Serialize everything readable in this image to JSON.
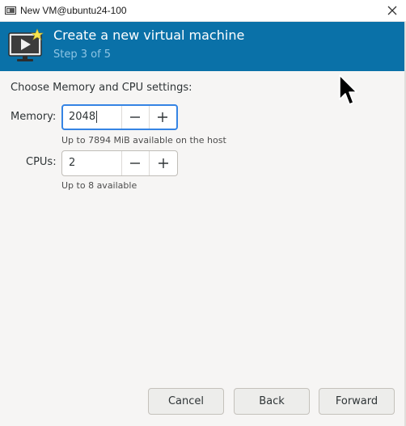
{
  "window": {
    "title": "New VM@ubuntu24-100",
    "app_icon": "virt-manager-icon",
    "close_icon": "close-icon"
  },
  "header": {
    "icon": "vm-screen-icon",
    "title": "Create a new virtual machine",
    "step": "Step 3 of 5",
    "background": "#0a71a8"
  },
  "main": {
    "section_label": "Choose Memory and CPU settings:",
    "memory": {
      "label": "Memory:",
      "value": "2048",
      "hint": "Up to 7894 MiB available on the host"
    },
    "cpus": {
      "label": "CPUs:",
      "value": "2",
      "hint": "Up to 8 available"
    }
  },
  "footer": {
    "cancel_label": "Cancel",
    "back_label": "Back",
    "forward_label": "Forward"
  },
  "colors": {
    "accent": "#3584e4"
  }
}
